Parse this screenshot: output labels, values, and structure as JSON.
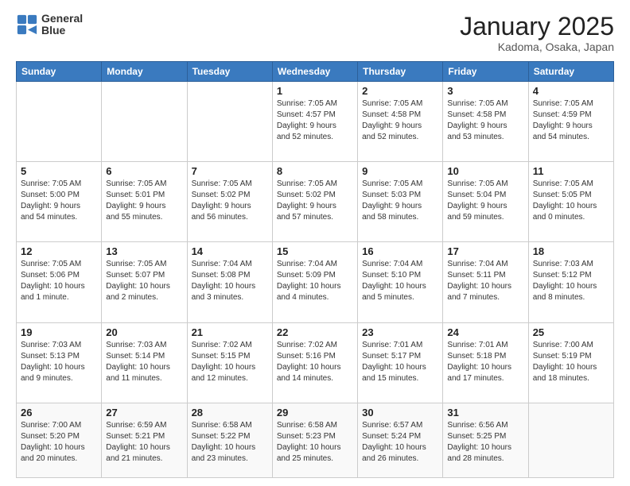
{
  "header": {
    "logo_line1": "General",
    "logo_line2": "Blue",
    "month": "January 2025",
    "location": "Kadoma, Osaka, Japan"
  },
  "weekdays": [
    "Sunday",
    "Monday",
    "Tuesday",
    "Wednesday",
    "Thursday",
    "Friday",
    "Saturday"
  ],
  "weeks": [
    [
      {
        "day": "",
        "info": ""
      },
      {
        "day": "",
        "info": ""
      },
      {
        "day": "",
        "info": ""
      },
      {
        "day": "1",
        "info": "Sunrise: 7:05 AM\nSunset: 4:57 PM\nDaylight: 9 hours\nand 52 minutes."
      },
      {
        "day": "2",
        "info": "Sunrise: 7:05 AM\nSunset: 4:58 PM\nDaylight: 9 hours\nand 52 minutes."
      },
      {
        "day": "3",
        "info": "Sunrise: 7:05 AM\nSunset: 4:58 PM\nDaylight: 9 hours\nand 53 minutes."
      },
      {
        "day": "4",
        "info": "Sunrise: 7:05 AM\nSunset: 4:59 PM\nDaylight: 9 hours\nand 54 minutes."
      }
    ],
    [
      {
        "day": "5",
        "info": "Sunrise: 7:05 AM\nSunset: 5:00 PM\nDaylight: 9 hours\nand 54 minutes."
      },
      {
        "day": "6",
        "info": "Sunrise: 7:05 AM\nSunset: 5:01 PM\nDaylight: 9 hours\nand 55 minutes."
      },
      {
        "day": "7",
        "info": "Sunrise: 7:05 AM\nSunset: 5:02 PM\nDaylight: 9 hours\nand 56 minutes."
      },
      {
        "day": "8",
        "info": "Sunrise: 7:05 AM\nSunset: 5:02 PM\nDaylight: 9 hours\nand 57 minutes."
      },
      {
        "day": "9",
        "info": "Sunrise: 7:05 AM\nSunset: 5:03 PM\nDaylight: 9 hours\nand 58 minutes."
      },
      {
        "day": "10",
        "info": "Sunrise: 7:05 AM\nSunset: 5:04 PM\nDaylight: 9 hours\nand 59 minutes."
      },
      {
        "day": "11",
        "info": "Sunrise: 7:05 AM\nSunset: 5:05 PM\nDaylight: 10 hours\nand 0 minutes."
      }
    ],
    [
      {
        "day": "12",
        "info": "Sunrise: 7:05 AM\nSunset: 5:06 PM\nDaylight: 10 hours\nand 1 minute."
      },
      {
        "day": "13",
        "info": "Sunrise: 7:05 AM\nSunset: 5:07 PM\nDaylight: 10 hours\nand 2 minutes."
      },
      {
        "day": "14",
        "info": "Sunrise: 7:04 AM\nSunset: 5:08 PM\nDaylight: 10 hours\nand 3 minutes."
      },
      {
        "day": "15",
        "info": "Sunrise: 7:04 AM\nSunset: 5:09 PM\nDaylight: 10 hours\nand 4 minutes."
      },
      {
        "day": "16",
        "info": "Sunrise: 7:04 AM\nSunset: 5:10 PM\nDaylight: 10 hours\nand 5 minutes."
      },
      {
        "day": "17",
        "info": "Sunrise: 7:04 AM\nSunset: 5:11 PM\nDaylight: 10 hours\nand 7 minutes."
      },
      {
        "day": "18",
        "info": "Sunrise: 7:03 AM\nSunset: 5:12 PM\nDaylight: 10 hours\nand 8 minutes."
      }
    ],
    [
      {
        "day": "19",
        "info": "Sunrise: 7:03 AM\nSunset: 5:13 PM\nDaylight: 10 hours\nand 9 minutes."
      },
      {
        "day": "20",
        "info": "Sunrise: 7:03 AM\nSunset: 5:14 PM\nDaylight: 10 hours\nand 11 minutes."
      },
      {
        "day": "21",
        "info": "Sunrise: 7:02 AM\nSunset: 5:15 PM\nDaylight: 10 hours\nand 12 minutes."
      },
      {
        "day": "22",
        "info": "Sunrise: 7:02 AM\nSunset: 5:16 PM\nDaylight: 10 hours\nand 14 minutes."
      },
      {
        "day": "23",
        "info": "Sunrise: 7:01 AM\nSunset: 5:17 PM\nDaylight: 10 hours\nand 15 minutes."
      },
      {
        "day": "24",
        "info": "Sunrise: 7:01 AM\nSunset: 5:18 PM\nDaylight: 10 hours\nand 17 minutes."
      },
      {
        "day": "25",
        "info": "Sunrise: 7:00 AM\nSunset: 5:19 PM\nDaylight: 10 hours\nand 18 minutes."
      }
    ],
    [
      {
        "day": "26",
        "info": "Sunrise: 7:00 AM\nSunset: 5:20 PM\nDaylight: 10 hours\nand 20 minutes."
      },
      {
        "day": "27",
        "info": "Sunrise: 6:59 AM\nSunset: 5:21 PM\nDaylight: 10 hours\nand 21 minutes."
      },
      {
        "day": "28",
        "info": "Sunrise: 6:58 AM\nSunset: 5:22 PM\nDaylight: 10 hours\nand 23 minutes."
      },
      {
        "day": "29",
        "info": "Sunrise: 6:58 AM\nSunset: 5:23 PM\nDaylight: 10 hours\nand 25 minutes."
      },
      {
        "day": "30",
        "info": "Sunrise: 6:57 AM\nSunset: 5:24 PM\nDaylight: 10 hours\nand 26 minutes."
      },
      {
        "day": "31",
        "info": "Sunrise: 6:56 AM\nSunset: 5:25 PM\nDaylight: 10 hours\nand 28 minutes."
      },
      {
        "day": "",
        "info": ""
      }
    ]
  ]
}
